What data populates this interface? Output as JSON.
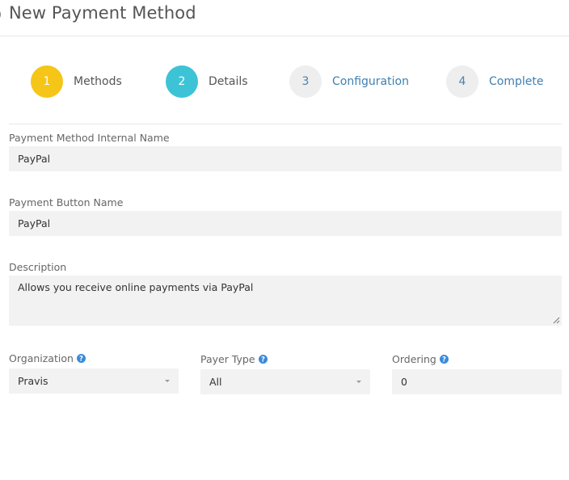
{
  "header": {
    "title": "New Payment Method"
  },
  "steps": [
    {
      "number": "1",
      "label": "Methods",
      "state": "done",
      "color": "#f5c518"
    },
    {
      "number": "2",
      "label": "Details",
      "state": "current",
      "color": "#3cc3d6"
    },
    {
      "number": "3",
      "label": "Configuration",
      "state": "todo"
    },
    {
      "number": "4",
      "label": "Complete",
      "state": "todo"
    }
  ],
  "form": {
    "internal_name": {
      "label": "Payment Method Internal Name",
      "value": "PayPal"
    },
    "button_name": {
      "label": "Payment Button Name",
      "value": "PayPal"
    },
    "description": {
      "label": "Description",
      "value": "Allows you receive online payments via PayPal"
    },
    "organization": {
      "label": "Organization",
      "value": "Pravis",
      "help_icon": "question-circle-icon"
    },
    "payer_type": {
      "label": "Payer Type",
      "value": "All",
      "help_icon": "question-circle-icon"
    },
    "ordering": {
      "label": "Ordering",
      "value": "0",
      "help_icon": "question-circle-icon"
    }
  },
  "colors": {
    "help_icon": "#3b8ad9",
    "link": "#3f7fb0"
  }
}
